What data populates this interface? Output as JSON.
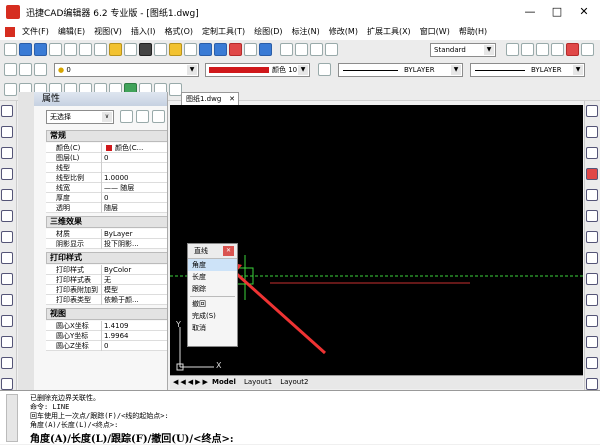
{
  "window": {
    "title": "迅捷CAD编辑器 6.2 专业版 - [图纸1.dwg]",
    "min": "—",
    "max": "□",
    "close": "✕"
  },
  "menu": [
    "文件(F)",
    "编辑(E)",
    "视图(V)",
    "插入(I)",
    "格式(O)",
    "定制工具(T)",
    "绘图(D)",
    "标注(N)",
    "修改(M)",
    "扩展工具(X)",
    "窗口(W)",
    "帮助(H)"
  ],
  "toolbar": {
    "text_style": "Standard",
    "layer_value": "0",
    "color_label": "颜色 10",
    "color_swatch": "#d0181b",
    "linetype": "BYLAYER",
    "lineweight": "BYLAYER"
  },
  "properties": {
    "title": "属性",
    "selection": "无选择",
    "sections": [
      {
        "name": "常规",
        "rows": [
          {
            "k": "颜色(C)",
            "v": "颜色(C..."
          },
          {
            "k": "图层(L)",
            "v": "0"
          },
          {
            "k": "线型",
            "v": ""
          },
          {
            "k": "线型比例",
            "v": "1.0000"
          },
          {
            "k": "线宽",
            "v": "—— 随层"
          },
          {
            "k": "厚度",
            "v": "0"
          },
          {
            "k": "透明",
            "v": "随层"
          }
        ]
      },
      {
        "name": "三维效果",
        "rows": [
          {
            "k": "材质",
            "v": "ByLayer"
          },
          {
            "k": "阴影显示",
            "v": "投下阴影..."
          }
        ]
      },
      {
        "name": "打印样式",
        "rows": [
          {
            "k": "打印样式",
            "v": "ByColor"
          },
          {
            "k": "打印样式表",
            "v": "无"
          },
          {
            "k": "打印表附加到",
            "v": "模型"
          },
          {
            "k": "打印表类型",
            "v": "依赖于颜..."
          }
        ]
      },
      {
        "name": "视图",
        "rows": [
          {
            "k": "圆心X坐标",
            "v": "1.4109"
          },
          {
            "k": "圆心Y坐标",
            "v": "1.9964"
          },
          {
            "k": "圆心Z坐标",
            "v": "0"
          }
        ]
      }
    ]
  },
  "drawing_tab": "图纸1.dwg",
  "context_menu": {
    "title": "直线",
    "items": [
      "角度",
      "长度",
      "跟踪",
      "撤回",
      "完成(S)",
      "取消"
    ]
  },
  "axis": {
    "y": "Y",
    "x": "X"
  },
  "layout_tabs": [
    "Model",
    "Layout1",
    "Layout2"
  ],
  "command_lines": [
    "已删除充边界关联性。",
    "命令:  LINE",
    "回车使用上一次点/跟踪(F)/<线的起始点>:",
    "角度(A)/长度(L)/<终点>:"
  ],
  "command_prompt": "角度(A)/长度(L)/跟踪(F)/撤回(U)/<终点>:"
}
